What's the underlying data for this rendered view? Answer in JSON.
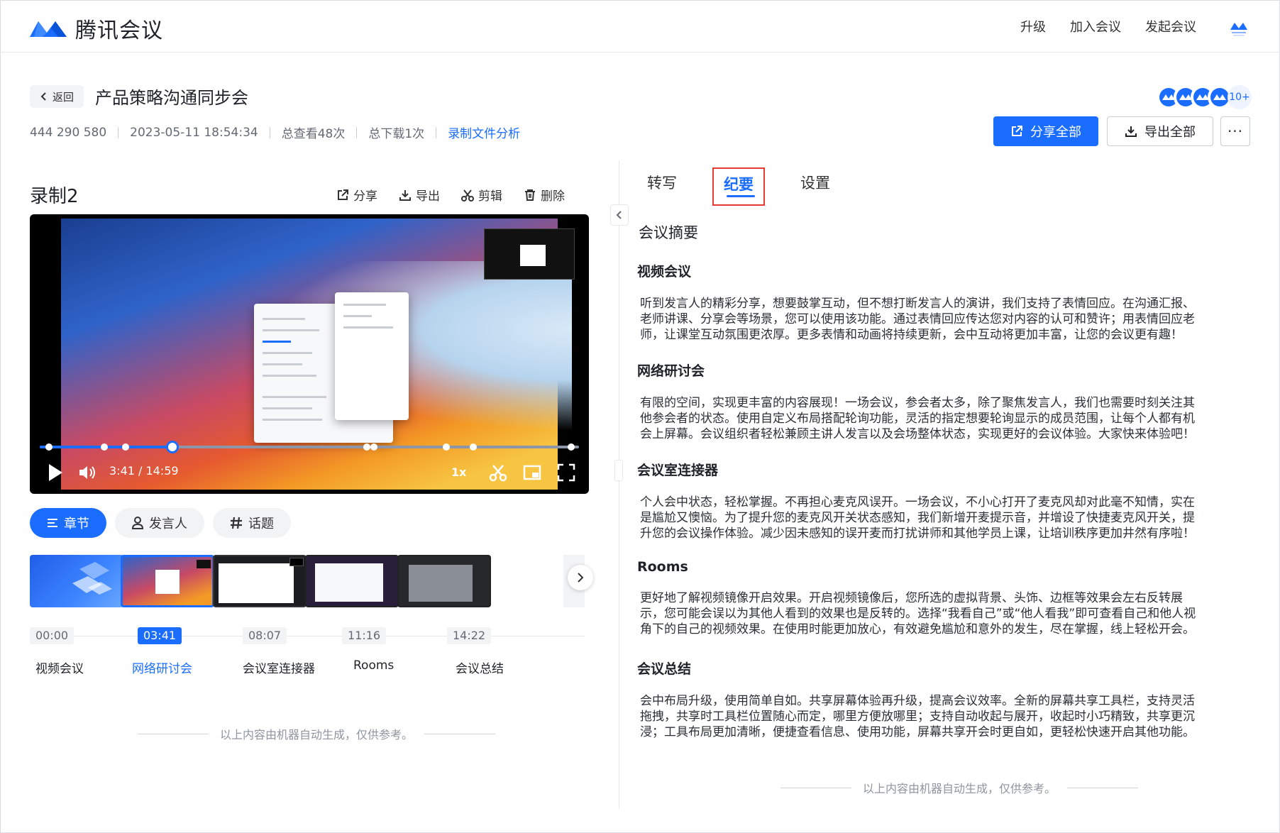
{
  "app": {
    "name": "腾讯会议"
  },
  "topnav": {
    "upgrade": "升级",
    "join": "加入会议",
    "start": "发起会议"
  },
  "meeting": {
    "back_label": "返回",
    "title": "产品策略沟通同步会",
    "id": "444 290 580",
    "datetime": "2023-05-11 18:54:34",
    "views": "总查看48次",
    "downloads": "总下载1次",
    "analysis_link": "录制文件分析",
    "participants_more": "10+",
    "share_all": "分享全部",
    "export_all": "导出全部",
    "more": "···"
  },
  "recording": {
    "title": "录制2",
    "tools": {
      "share": "分享",
      "export": "导出",
      "clip": "剪辑",
      "delete": "删除"
    },
    "player": {
      "current": "3:41",
      "total": "14:59",
      "speed": "1x",
      "progress": 0.246
    },
    "chips": [
      {
        "label": "章节",
        "active": true
      },
      {
        "label": "发言人",
        "active": false
      },
      {
        "label": "话题",
        "active": false
      }
    ],
    "chapters": [
      {
        "time": "00:00",
        "label": "视频会议",
        "selected": false
      },
      {
        "time": "03:41",
        "label": "网络研讨会",
        "selected": true
      },
      {
        "time": "08:07",
        "label": "会议室连接器",
        "selected": false
      },
      {
        "time": "11:16",
        "label": "Rooms",
        "selected": false
      },
      {
        "time": "14:22",
        "label": "会议总结",
        "selected": false
      }
    ],
    "footnote": "以上内容由机器自动生成，仅供参考。"
  },
  "panel": {
    "tabs": [
      {
        "label": "转写",
        "active": false
      },
      {
        "label": "纪要",
        "active": true
      },
      {
        "label": "设置",
        "active": false
      }
    ],
    "summary_title": "会议摘要",
    "sections": [
      {
        "title": "视频会议",
        "lines": [
          "听到发言人的精彩分享，想要鼓掌互动，但不想打断发言人的演讲，我们支持了表情回应。在沟通汇报、",
          "老师讲课、分享会等场景，您可以使用该功能。通过表情回应传达您对内容的认可和赞许；用表情回应老",
          "师，让课堂互动氛围更浓厚。更多表情和动画将持续更新，会中互动将更加丰富，让您的会议更有趣！"
        ]
      },
      {
        "title": "网络研讨会",
        "lines": [
          "有限的空间，实现更丰富的内容展现！一场会议，参会者太多，除了聚焦发言人，我们也需要时刻关注其",
          "他参会者的状态。使用自定义布局搭配轮询功能，灵活的指定想要轮询显示的成员范围，让每个人都有机",
          "会上屏幕。会议组织者轻松兼顾主讲人发言以及会场整体状态，实现更好的会议体验。大家快来体验吧！"
        ]
      },
      {
        "title": "会议室连接器",
        "lines": [
          "个人会中状态，轻松掌握。不再担心麦克风误开。一场会议，不小心打开了麦克风却对此毫不知情，实在",
          "是尴尬又懊恼。为了提升您的麦克风开关状态感知，我们新增开麦提示音，并增设了快捷麦克风开关，提",
          "升您的会议操作体验。减少因未感知的误开麦而打扰讲师和其他学员上课，让培训秩序更加井然有序啦！"
        ]
      },
      {
        "title": "Rooms",
        "lines": [
          "更好地了解视频镜像开启效果。开启视频镜像后，您所选的虚拟背景、头饰、边框等效果会左右反转展",
          "示，您可能会误以为其他人看到的效果也是反转的。选择“我看自己”或“他人看我”即可查看自己和他人视",
          "角下的自己的视频效果。在使用时能更加放心，有效避免尴尬和意外的发生，尽在掌握，线上轻松开会。"
        ]
      },
      {
        "title": "会议总结",
        "lines": [
          "会中布局升级，使用简单自如。共享屏幕体验再升级，提高会议效率。全新的屏幕共享工具栏，支持灵活",
          "拖拽，共享时工具栏位置随心而定，哪里方便放哪里；支持自动收起与展开，收起时小巧精致，共享更沉",
          "浸；工具布局更加清晰，便捷查看信息、使用功能，屏幕共享开会时更自如，更轻松快速开启其他功能。"
        ]
      }
    ],
    "footnote": "以上内容由机器自动生成，仅供参考。"
  },
  "colors": {
    "primary": "#1a6dff",
    "highlight_border": "#e53935"
  }
}
